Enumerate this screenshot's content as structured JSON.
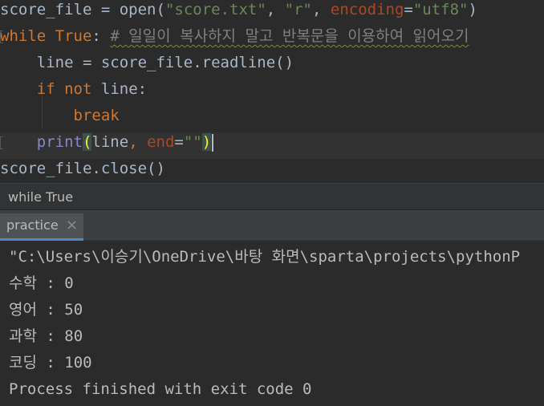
{
  "editor": {
    "lines": [
      {
        "tokens": [
          {
            "text": "score_file",
            "kind": "ident"
          },
          {
            "text": " = ",
            "kind": "ident"
          },
          {
            "text": "open",
            "kind": "ident"
          },
          {
            "text": "(",
            "kind": "ident"
          },
          {
            "text": "\"score.txt\"",
            "kind": "str"
          },
          {
            "text": ", ",
            "kind": "ident"
          },
          {
            "text": "\"r\"",
            "kind": "str"
          },
          {
            "text": ", ",
            "kind": "ident"
          },
          {
            "text": "encoding",
            "kind": "param"
          },
          {
            "text": "=",
            "kind": "ident"
          },
          {
            "text": "\"utf8\"",
            "kind": "str"
          },
          {
            "text": ")",
            "kind": "ident"
          }
        ]
      },
      {
        "tokens": [
          {
            "text": "while",
            "kind": "kw"
          },
          {
            "text": " ",
            "kind": "ident"
          },
          {
            "text": "True",
            "kind": "kw"
          },
          {
            "text": ":",
            "kind": "ident"
          },
          {
            "text": " ",
            "kind": "ident"
          },
          {
            "text": "# 일일이 복사하지 말고 반복문을 이용하여 읽어오기",
            "kind": "comment"
          }
        ]
      },
      {
        "tokens": [
          {
            "text": "    line = score_file.readline()",
            "kind": "ident"
          }
        ]
      },
      {
        "tokens": [
          {
            "text": "    ",
            "kind": "ident"
          },
          {
            "text": "if",
            "kind": "kw"
          },
          {
            "text": " ",
            "kind": "ident"
          },
          {
            "text": "not",
            "kind": "kw"
          },
          {
            "text": " line:",
            "kind": "ident"
          }
        ]
      },
      {
        "tokens": [
          {
            "text": "        ",
            "kind": "ident"
          },
          {
            "text": "break",
            "kind": "kw"
          }
        ]
      },
      {
        "tokens": [
          {
            "text": "    ",
            "kind": "ident"
          },
          {
            "text": "print",
            "kind": "builtin"
          },
          {
            "text": "(",
            "kind": "paren-hl"
          },
          {
            "text": "line",
            "kind": "ident"
          },
          {
            "text": ", ",
            "kind": "kw"
          },
          {
            "text": "end",
            "kind": "param"
          },
          {
            "text": "=",
            "kind": "ident"
          },
          {
            "text": "\"\"",
            "kind": "str"
          },
          {
            "text": ")",
            "kind": "paren-hl"
          }
        ]
      },
      {
        "tokens": [
          {
            "text": "score_file.close()",
            "kind": "ident"
          }
        ]
      }
    ]
  },
  "breadcrumb": {
    "text": "while True"
  },
  "run_panel": {
    "tab_label": "practice",
    "close_glyph": "×"
  },
  "console": {
    "lines": [
      "\"C:\\Users\\이승기\\OneDrive\\바탕 화면\\sparta\\projects\\pythonP",
      "수학 : 0",
      "영어 : 50",
      "과학 : 80",
      "코딩 : 100",
      "Process finished with exit code 0"
    ]
  }
}
